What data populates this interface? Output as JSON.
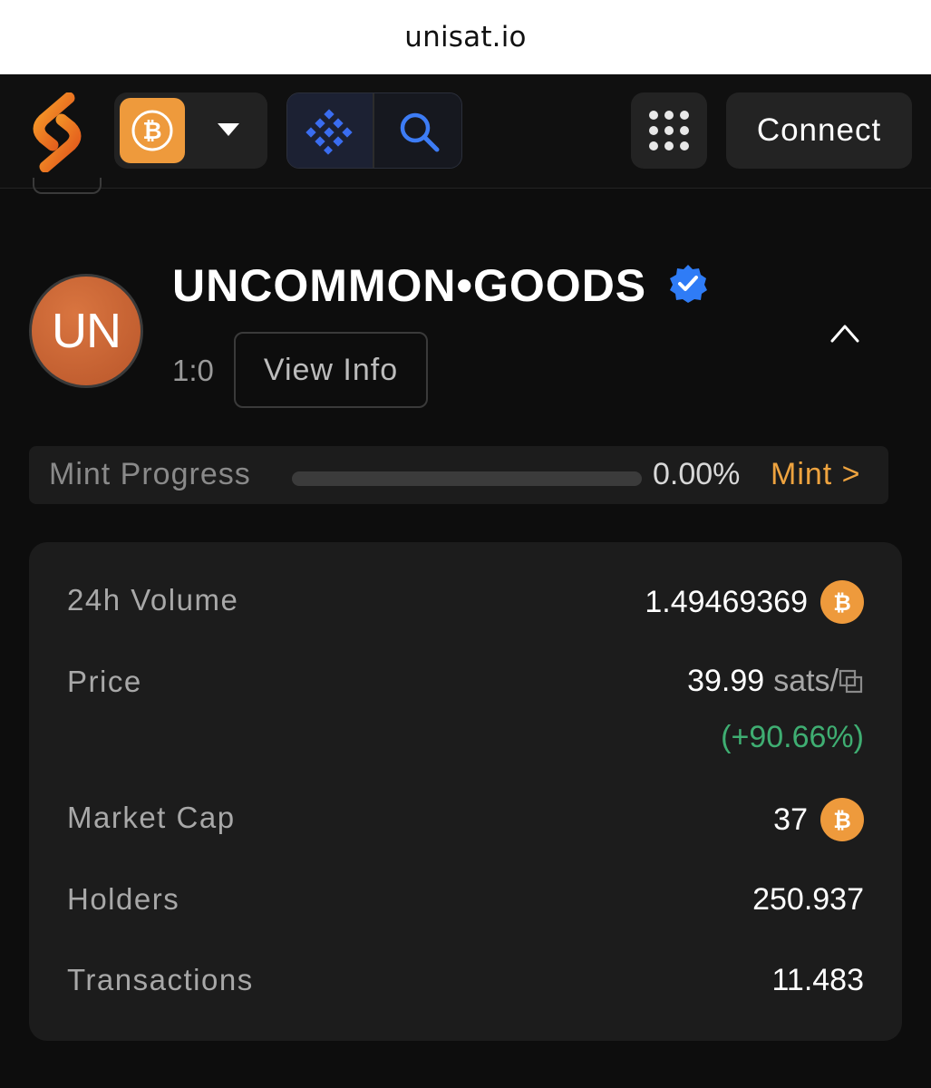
{
  "browser": {
    "url": "unisat.io"
  },
  "header": {
    "chain_icon": "bitcoin-icon",
    "connect_label": "Connect"
  },
  "token": {
    "avatar_text": "UN",
    "name": "UNCOMMON•GOODS",
    "ratio": "1:0",
    "view_info_label": "View Info"
  },
  "mint": {
    "label": "Mint Progress",
    "progress_percent": 0,
    "percent_text": "0.00%",
    "link_label": "Mint >"
  },
  "stats": {
    "volume_label": "24h Volume",
    "volume_value": "1.49469369",
    "price_label": "Price",
    "price_value": "39.99",
    "price_unit": "sats/",
    "price_change": "(+90.66%)",
    "market_cap_label": "Market Cap",
    "market_cap_value": "37",
    "holders_label": "Holders",
    "holders_value": "250.937",
    "transactions_label": "Transactions",
    "transactions_value": "11.483"
  },
  "colors": {
    "accent": "#ee9a3c",
    "positive": "#3fae72",
    "verified": "#2f7cf6"
  }
}
